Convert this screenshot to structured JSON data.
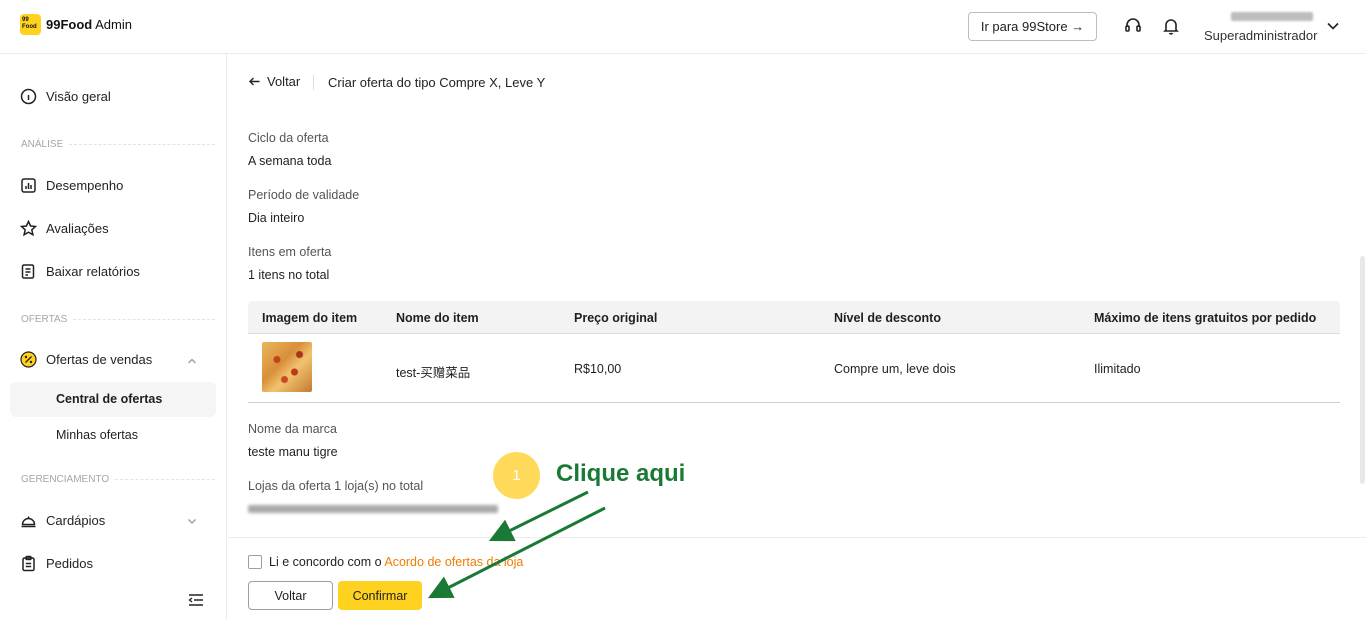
{
  "header": {
    "logo_mark": "99 Food",
    "logo_brand": "99Food",
    "logo_suffix": " Admin",
    "store_button": "Ir para 99Store →",
    "user_role": "Superadministrador"
  },
  "sidebar": {
    "overview": "Visão geral",
    "section_analysis": "ANÁLISE",
    "performance": "Desempenho",
    "reviews": "Avaliações",
    "reports": "Baixar relatórios",
    "section_offers": "OFERTAS",
    "sales_offers": "Ofertas de vendas",
    "offers_central": "Central de ofertas",
    "my_offers": "Minhas ofertas",
    "section_management": "GERENCIAMENTO",
    "menus": "Cardápios",
    "orders": "Pedidos"
  },
  "main": {
    "back": "Voltar",
    "title": "Criar oferta do tipo Compre X, Leve Y",
    "fields": [
      {
        "label": "Ciclo da oferta",
        "value": "A semana toda"
      },
      {
        "label": "Período de validade",
        "value": "Dia inteiro"
      },
      {
        "label": "Itens em oferta",
        "value": "1 itens no total"
      }
    ],
    "table": {
      "headers": [
        "Imagem do item",
        "Nome do item",
        "Preço original",
        "Nível de desconto",
        "Máximo de itens gratuitos por pedido"
      ],
      "rows": [
        {
          "name": "test-买赠菜品",
          "price": "R$10,00",
          "discount": "Compre um, leve dois",
          "max_free": "Ilimitado"
        }
      ]
    },
    "brand_label": "Nome da marca",
    "brand_value": "teste manu tigre",
    "stores_label": "Lojas da oferta 1 loja(s) no total"
  },
  "footer": {
    "agree_text": "Li e concordo com o ",
    "agree_link": "Acordo de ofertas da loja",
    "back_button": "Voltar",
    "confirm_button": "Confirmar"
  },
  "annotation": {
    "step": "1",
    "callout": "Clique aqui",
    "color": "#1a7a35"
  }
}
